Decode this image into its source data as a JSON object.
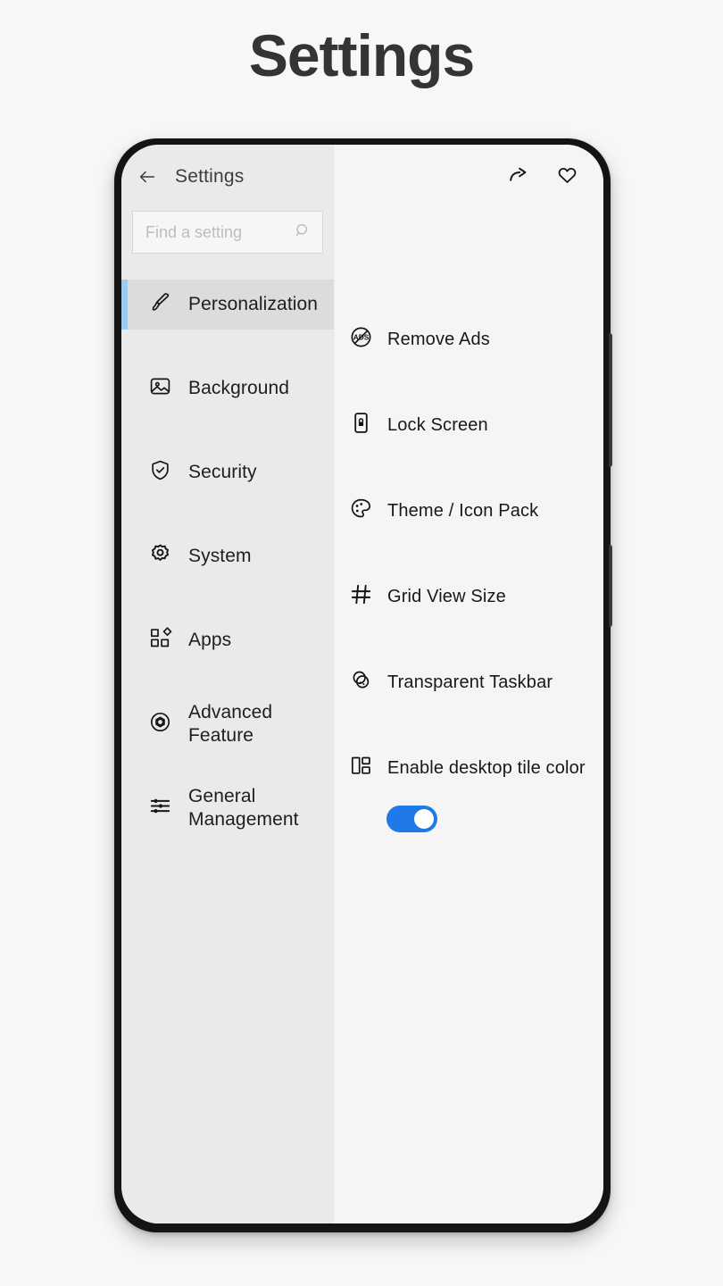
{
  "page": {
    "title": "Settings",
    "background_color": "#f7f7f7"
  },
  "phone": {
    "frame_color": "#141414",
    "side_buttons": [
      "volume-rocker",
      "power-button"
    ]
  },
  "app": {
    "header": {
      "back_icon": "back-arrow-icon",
      "title": "Settings",
      "share_icon": "share-icon",
      "favorite_icon": "heart-icon"
    },
    "search": {
      "placeholder": "Find a setting",
      "value": "",
      "icon": "search-icon"
    },
    "sidebar": {
      "background_color": "#eaeaea",
      "selected_background_color": "#dcdcdc",
      "accent_color": "#9fcaee",
      "items": [
        {
          "label": "Personalization",
          "icon": "paintbrush-icon",
          "selected": true
        },
        {
          "label": "Background",
          "icon": "image-icon",
          "selected": false
        },
        {
          "label": "Security",
          "icon": "shield-check-icon",
          "selected": false
        },
        {
          "label": "System",
          "icon": "gear-icon",
          "selected": false
        },
        {
          "label": "Apps",
          "icon": "apps-grid-icon",
          "selected": false
        },
        {
          "label": "Advanced Feature",
          "icon": "hexagon-dot-icon",
          "selected": false
        },
        {
          "label": "General Management",
          "icon": "sliders-icon",
          "selected": false
        }
      ]
    },
    "content": {
      "background_color": "#f5f5f5",
      "items": [
        {
          "label": "Remove Ads",
          "icon": "no-ads-icon"
        },
        {
          "label": "Lock Screen",
          "icon": "lock-screen-icon"
        },
        {
          "label": "Theme / Icon Pack",
          "icon": "palette-icon"
        },
        {
          "label": "Grid View Size",
          "icon": "grid-icon"
        },
        {
          "label": "Transparent Taskbar",
          "icon": "transparency-circles-icon"
        },
        {
          "label": "Enable desktop tile color",
          "icon": "tiles-icon"
        }
      ],
      "toggle": {
        "name": "enable-desktop-tile-color-toggle",
        "state": "on",
        "on_color": "#1f7ae8",
        "knob_color": "#ffffff"
      }
    }
  }
}
